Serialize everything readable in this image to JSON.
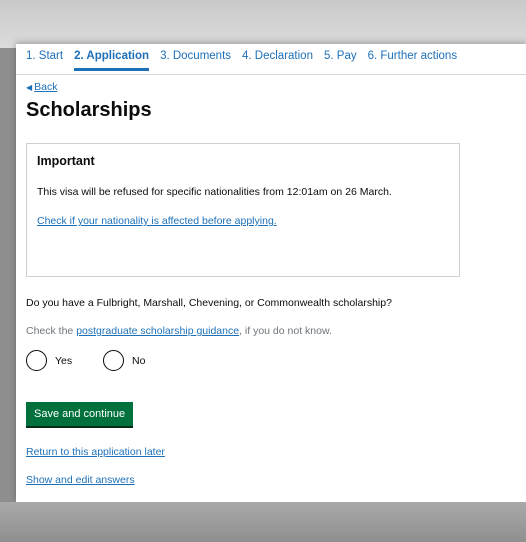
{
  "steps": [
    {
      "label": "1. Start"
    },
    {
      "label": "2. Application"
    },
    {
      "label": "3. Documents"
    },
    {
      "label": "4. Declaration"
    },
    {
      "label": "5. Pay"
    },
    {
      "label": "6. Further actions"
    }
  ],
  "current_step_index": 1,
  "back_label": "Back",
  "page_title": "Scholarships",
  "important": {
    "heading": "Important",
    "text": "This visa will be refused for specific nationalities from 12:01am on 26 March.",
    "link": "Check if your nationality is affected before applying."
  },
  "question": "Do you have a Fulbright, Marshall, Chevening, or Commonwealth scholarship?",
  "hint": {
    "before": "Check the ",
    "link": "postgraduate scholarship guidance",
    "after": ", if you do not know."
  },
  "options": {
    "yes": "Yes",
    "no": "No"
  },
  "save_button": "Save and continue",
  "return_link": "Return to this application later",
  "show_link": "Show and edit answers",
  "colors": {
    "link": "#1d70b8",
    "button": "#00703c",
    "text": "#0b0c0c"
  },
  "icons": {
    "back": "back-triangle-icon"
  }
}
